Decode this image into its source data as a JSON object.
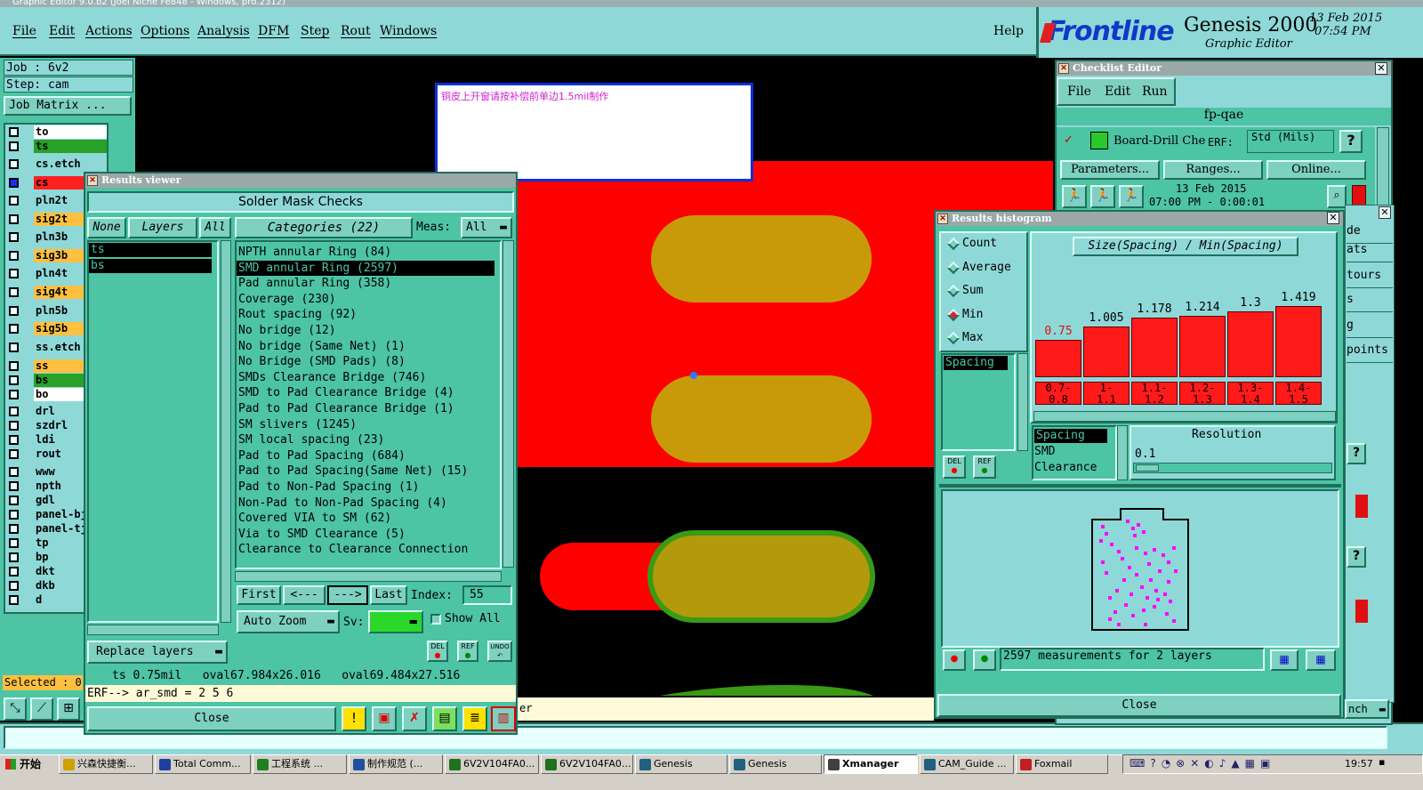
{
  "window": {
    "title": "Graphic Editor 9.0.b2 (Joel Niche Fe848 - Windows, prd.2312)"
  },
  "menu": [
    "File",
    "Edit",
    "Actions",
    "Options",
    "Analysis",
    "DFM",
    "Step",
    "Rout",
    "Windows"
  ],
  "help_label": "Help",
  "brand": {
    "logo": "Frontline",
    "product": "Genesis 2000",
    "subtitle": "Graphic Editor",
    "date": "13 Feb 2015",
    "time": "07:54 PM"
  },
  "job": {
    "job_label": "Job :  6v2",
    "step_label": "Step:  cam",
    "job_matrix": "Job Matrix ..."
  },
  "layers": [
    {
      "name": "to",
      "color": "#ffffff"
    },
    {
      "name": "ts",
      "color": "#27a127"
    },
    {
      "name": "cs.etch",
      "color": "#8fd8d8"
    },
    {
      "name": "cs",
      "color": "#ff2020"
    },
    {
      "name": "pln2t",
      "color": "#8fd8d8"
    },
    {
      "name": "sig2t",
      "color": "#ffc040"
    },
    {
      "name": "pln3b",
      "color": "#8fd8d8"
    },
    {
      "name": "sig3b",
      "color": "#ffc040"
    },
    {
      "name": "pln4t",
      "color": "#8fd8d8"
    },
    {
      "name": "sig4t",
      "color": "#ffc040"
    },
    {
      "name": "pln5b",
      "color": "#8fd8d8"
    },
    {
      "name": "sig5b",
      "color": "#ffc040"
    },
    {
      "name": "ss.etch",
      "color": "#8fd8d8"
    },
    {
      "name": "ss",
      "color": "#ffc040"
    },
    {
      "name": "bs",
      "color": "#27a127"
    },
    {
      "name": "bo",
      "color": "#ffffff"
    },
    {
      "name": "drl",
      "color": "#8fd8d8"
    },
    {
      "name": "szdrl",
      "color": "#8fd8d8"
    },
    {
      "name": "ldi",
      "color": "#8fd8d8"
    },
    {
      "name": "rout",
      "color": "#8fd8d8"
    },
    {
      "name": "www",
      "color": "#8fd8d8"
    },
    {
      "name": "npth",
      "color": "#8fd8d8"
    },
    {
      "name": "gdl",
      "color": "#8fd8d8"
    },
    {
      "name": "panel-bj",
      "color": "#8fd8d8"
    },
    {
      "name": "panel-tj",
      "color": "#8fd8d8"
    },
    {
      "name": "tp",
      "color": "#8fd8d8"
    },
    {
      "name": "bp",
      "color": "#8fd8d8"
    },
    {
      "name": "dkt",
      "color": "#8fd8d8"
    },
    {
      "name": "dkb",
      "color": "#8fd8d8"
    },
    {
      "name": "d",
      "color": "#8fd8d8"
    }
  ],
  "selected_label": "Selected : 0",
  "note_text": "铜皮上开窗请按补偿前单边1.5mil制作",
  "results_viewer": {
    "title": "Results viewer",
    "header": "Solder Mask Checks",
    "none_btn": "None",
    "layers_btn": "Layers",
    "all_btn": "All",
    "layer_list": [
      "ts",
      "bs"
    ],
    "categories_btn": "Categories (22)",
    "meas_label": "Meas:",
    "meas_value": "All",
    "categories": [
      "NPTH annular Ring (84)",
      "SMD annular Ring (2597)",
      "Pad annular Ring (358)",
      "Coverage (230)",
      "Rout spacing (92)",
      "No bridge (12)",
      "No bridge (Same Net) (1)",
      "No Bridge (SMD Pads) (8)",
      "SMDs Clearance Bridge (746)",
      "SMD to Pad Clearance Bridge (4)",
      "Pad to Pad Clearance Bridge (1)",
      "SM slivers (1245)",
      "SM local spacing (23)",
      "Pad to Pad Spacing (684)",
      "Pad to Pad Spacing(Same Net) (15)",
      "Pad to Non-Pad Spacing (1)",
      "Non-Pad to Non-Pad Spacing (4)",
      "Covered VIA to SM (62)",
      "Via to SMD Clearance (5)",
      "Clearance to Clearance Connection"
    ],
    "selected_category": 1,
    "first": "First",
    "prev": "<---",
    "next": "--->",
    "last": "Last",
    "index_label": "Index:",
    "index_value": "55",
    "auto_zoom": "Auto Zoom",
    "sv_label": "Sv:",
    "show_all": "Show All",
    "replace_layers": "Replace layers",
    "status_line": "ts 0.75mil   oval67.984x26.016   oval69.484x27.516",
    "erf_line": "ERF--> ar_smd = 2 5 6",
    "close": "Close",
    "del_icon": "DEL",
    "ref_icon": "REF",
    "undo_icon": "UNDO"
  },
  "checklist_editor": {
    "title": "Checklist Editor",
    "menu": [
      "File",
      "Edit",
      "Run"
    ],
    "name": "fp-qae",
    "action_name": "Board-Drill Che",
    "erf_label": "ERF:",
    "erf_value": "Std (Mils)",
    "parameters": "Parameters...",
    "ranges": "Ranges...",
    "online": "Online...",
    "run_date": "13 Feb 2015",
    "run_time": "07:00 PM - 0:00:01",
    "right_labels": [
      "de",
      "ats",
      "tours",
      "s",
      "g",
      "points"
    ],
    "bottom_btn": "nch"
  },
  "histogram": {
    "title": "Results histogram",
    "options": [
      "Count",
      "Average",
      "Sum",
      "Min",
      "Max"
    ],
    "selected_option": "Min",
    "measure_list": [
      "Spacing"
    ],
    "chart_title": "Size(Spacing) / Min(Spacing)",
    "bar_values": [
      "0.75",
      "1.005",
      "1.178",
      "1.214",
      "1.3",
      "1.419"
    ],
    "bin_labels": [
      [
        "0.7-",
        "0.8"
      ],
      [
        "1-",
        "1.1"
      ],
      [
        "1.1-",
        "1.2"
      ],
      [
        "1.2-",
        "1.3"
      ],
      [
        "1.3-",
        "1.4"
      ],
      [
        "1.4-",
        "1.5"
      ]
    ],
    "type_list": [
      "Spacing",
      "SMD",
      "Clearance"
    ],
    "resolution_label": "Resolution",
    "resolution_value": "0.1",
    "summary": "2597 measurements for 2 layers",
    "close": "Close",
    "del_icon": "DEL",
    "ref_icon": "REF"
  },
  "chart_data": {
    "type": "bar",
    "title": "Size(Spacing) / Min(Spacing)",
    "categories": [
      "0.7-0.8",
      "1-1.1",
      "1.1-1.2",
      "1.2-1.3",
      "1.3-1.4",
      "1.4-1.5"
    ],
    "values": [
      0.75,
      1.005,
      1.178,
      1.214,
      1.3,
      1.419
    ],
    "ylim": [
      0,
      1.45
    ]
  },
  "editor_status_frag": "er",
  "taskbar": {
    "start": "开始",
    "items": [
      "兴森快捷衡...",
      "Total Comm...",
      "工程系统   ...",
      "制作规范 (...",
      "6V2V104FA0...",
      "6V2V104FA0...",
      "Genesis",
      "Genesis",
      "Xmanager",
      "CAM_Guide ...",
      "Foxmail"
    ],
    "clock": "19:57"
  }
}
